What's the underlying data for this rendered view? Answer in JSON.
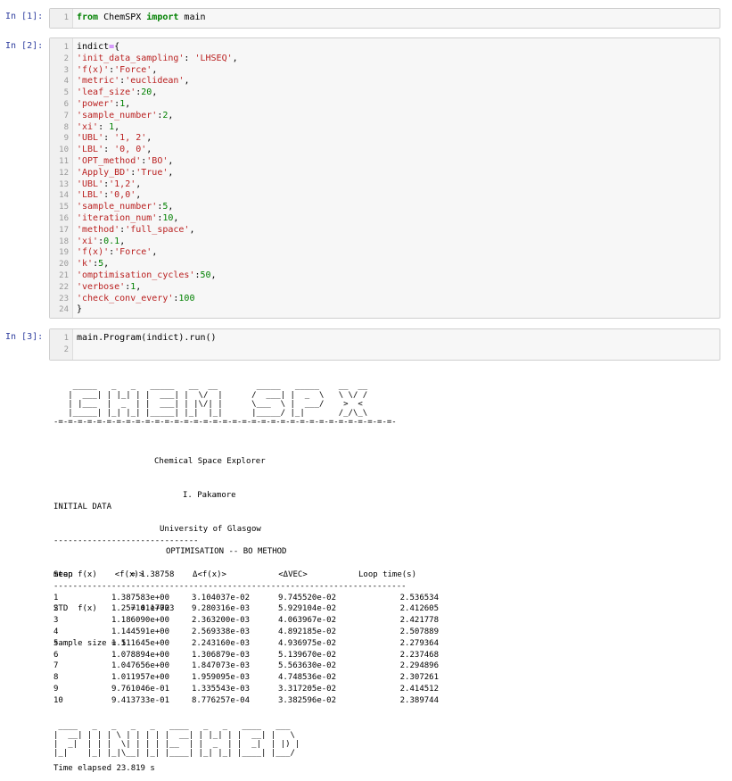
{
  "cells": [
    {
      "prompt": "In [1]:",
      "lines": [
        [
          {
            "t": "from",
            "c": "kw"
          },
          {
            "t": " ChemSPX ",
            "c": ""
          },
          {
            "t": "import",
            "c": "kw"
          },
          {
            "t": " main",
            "c": ""
          }
        ]
      ]
    },
    {
      "prompt": "In [2]:",
      "lines": [
        [
          {
            "t": "indict",
            "c": ""
          },
          {
            "t": "=",
            "c": "op"
          },
          {
            "t": "{",
            "c": ""
          }
        ],
        [
          {
            "t": "'init_data_sampling'",
            "c": "str"
          },
          {
            "t": ": ",
            "c": ""
          },
          {
            "t": "'LHSEQ'",
            "c": "str"
          },
          {
            "t": ",",
            "c": ""
          }
        ],
        [
          {
            "t": "'f(x)'",
            "c": "str"
          },
          {
            "t": ":",
            "c": ""
          },
          {
            "t": "'Force'",
            "c": "str"
          },
          {
            "t": ",",
            "c": ""
          }
        ],
        [
          {
            "t": "'metric'",
            "c": "str"
          },
          {
            "t": ":",
            "c": ""
          },
          {
            "t": "'euclidean'",
            "c": "str"
          },
          {
            "t": ",",
            "c": ""
          }
        ],
        [
          {
            "t": "'leaf_size'",
            "c": "str"
          },
          {
            "t": ":",
            "c": ""
          },
          {
            "t": "20",
            "c": "num"
          },
          {
            "t": ",",
            "c": ""
          }
        ],
        [
          {
            "t": "'power'",
            "c": "str"
          },
          {
            "t": ":",
            "c": ""
          },
          {
            "t": "1",
            "c": "num"
          },
          {
            "t": ",",
            "c": ""
          }
        ],
        [
          {
            "t": "'sample_number'",
            "c": "str"
          },
          {
            "t": ":",
            "c": ""
          },
          {
            "t": "2",
            "c": "num"
          },
          {
            "t": ",",
            "c": ""
          }
        ],
        [
          {
            "t": "'xi'",
            "c": "str"
          },
          {
            "t": ": ",
            "c": ""
          },
          {
            "t": "1",
            "c": "num"
          },
          {
            "t": ",",
            "c": ""
          }
        ],
        [
          {
            "t": "'UBL'",
            "c": "str"
          },
          {
            "t": ": ",
            "c": ""
          },
          {
            "t": "'1, 2'",
            "c": "str"
          },
          {
            "t": ",",
            "c": ""
          }
        ],
        [
          {
            "t": "'LBL'",
            "c": "str"
          },
          {
            "t": ": ",
            "c": ""
          },
          {
            "t": "'0, 0'",
            "c": "str"
          },
          {
            "t": ",",
            "c": ""
          }
        ],
        [
          {
            "t": "'OPT_method'",
            "c": "str"
          },
          {
            "t": ":",
            "c": ""
          },
          {
            "t": "'BO'",
            "c": "str"
          },
          {
            "t": ",",
            "c": ""
          }
        ],
        [
          {
            "t": "'Apply_BD'",
            "c": "str"
          },
          {
            "t": ":",
            "c": ""
          },
          {
            "t": "'True'",
            "c": "str"
          },
          {
            "t": ",",
            "c": ""
          }
        ],
        [
          {
            "t": "'UBL'",
            "c": "str"
          },
          {
            "t": ":",
            "c": ""
          },
          {
            "t": "'1,2'",
            "c": "str"
          },
          {
            "t": ",",
            "c": ""
          }
        ],
        [
          {
            "t": "'LBL'",
            "c": "str"
          },
          {
            "t": ":",
            "c": ""
          },
          {
            "t": "'0,0'",
            "c": "str"
          },
          {
            "t": ",",
            "c": ""
          }
        ],
        [
          {
            "t": "'sample_number'",
            "c": "str"
          },
          {
            "t": ":",
            "c": ""
          },
          {
            "t": "5",
            "c": "num"
          },
          {
            "t": ",",
            "c": ""
          }
        ],
        [
          {
            "t": "'iteration_num'",
            "c": "str"
          },
          {
            "t": ":",
            "c": ""
          },
          {
            "t": "10",
            "c": "num"
          },
          {
            "t": ",",
            "c": ""
          }
        ],
        [
          {
            "t": "'method'",
            "c": "str"
          },
          {
            "t": ":",
            "c": ""
          },
          {
            "t": "'full_space'",
            "c": "str"
          },
          {
            "t": ",",
            "c": ""
          }
        ],
        [
          {
            "t": "'xi'",
            "c": "str"
          },
          {
            "t": ":",
            "c": ""
          },
          {
            "t": "0.1",
            "c": "num"
          },
          {
            "t": ",",
            "c": ""
          }
        ],
        [
          {
            "t": "'f(x)'",
            "c": "str"
          },
          {
            "t": ":",
            "c": ""
          },
          {
            "t": "'Force'",
            "c": "str"
          },
          {
            "t": ",",
            "c": ""
          }
        ],
        [
          {
            "t": "'k'",
            "c": "str"
          },
          {
            "t": ":",
            "c": ""
          },
          {
            "t": "5",
            "c": "num"
          },
          {
            "t": ",",
            "c": ""
          }
        ],
        [
          {
            "t": "'omptimisation_cycles'",
            "c": "str"
          },
          {
            "t": ":",
            "c": ""
          },
          {
            "t": "50",
            "c": "num"
          },
          {
            "t": ",",
            "c": ""
          }
        ],
        [
          {
            "t": "'verbose'",
            "c": "str"
          },
          {
            "t": ":",
            "c": ""
          },
          {
            "t": "1",
            "c": "num"
          },
          {
            "t": ",",
            "c": ""
          }
        ],
        [
          {
            "t": "'check_conv_every'",
            "c": "str"
          },
          {
            "t": ":",
            "c": ""
          },
          {
            "t": "100",
            "c": "num"
          }
        ],
        [
          {
            "t": "}",
            "c": ""
          }
        ]
      ]
    },
    {
      "prompt": "In [3]:",
      "lines": [
        [
          {
            "t": "main.Program(indict).run()",
            "c": ""
          }
        ],
        [
          {
            "t": "",
            "c": ""
          }
        ]
      ]
    }
  ],
  "banner_top": [
    "    _____   _   _   _____   __  __        _____   _____    __  __",
    "   |  ___| | |_| | |  ___| |  \\/  |      /  ___| |  _  \\   \\ \\/ /",
    "   | |___  |  _  | |  ___| | |\\/| |      \\___  \\ |  ___/    >  <",
    "   |_____| |_| |_| |_____| |_|  |_|      |_____/ |_|       /_/\\_\\",
    "-=-=-=-=-=-=-=-=-=-=-=-=-=-=-=-=-=-=-=-=-=-=-=-=-=-=-=-=-=-=-=-=-=-=-=-"
  ],
  "header": {
    "title": "Chemical Space Explorer",
    "author": "I. Pakamore",
    "affiliation": "University of Glasgow"
  },
  "initial": {
    "heading": "INITIAL DATA",
    "rule": "------------------------------",
    "mean": "mean f(x)       = 1.38758",
    "std": "STD  f(x)       = 0.17723",
    "size": "sample size = 5"
  },
  "opt_heading": "OPTIMISATION -- BO METHOD",
  "table": {
    "headers": [
      "Step",
      "<f(x)>",
      "Δ<f(x)>",
      "<ΔVEC>",
      "Loop time(s)"
    ],
    "rule": "-------------------------------------------------------------------------",
    "rows": [
      [
        "1",
        "1.387583e+00",
        "3.104037e-02",
        "9.745520e-02",
        "2.536534"
      ],
      [
        "2",
        "1.257141e+00",
        "9.280316e-03",
        "5.929104e-02",
        "2.412605"
      ],
      [
        "3",
        "1.186090e+00",
        "2.363200e-03",
        "4.063967e-02",
        "2.421778"
      ],
      [
        "4",
        "1.144591e+00",
        "2.569338e-03",
        "4.892185e-02",
        "2.507889"
      ],
      [
        "5",
        "1.111645e+00",
        "2.243160e-03",
        "4.936975e-02",
        "2.279364"
      ],
      [
        "6",
        "1.078894e+00",
        "1.306879e-03",
        "5.139670e-02",
        "2.237468"
      ],
      [
        "7",
        "1.047656e+00",
        "1.847073e-03",
        "5.563630e-02",
        "2.294896"
      ],
      [
        "8",
        "1.011957e+00",
        "1.959095e-03",
        "4.748536e-02",
        "2.307261"
      ],
      [
        "9",
        "9.761046e-01",
        "1.335543e-03",
        "3.317205e-02",
        "2.414512"
      ],
      [
        "10",
        "9.413733e-01",
        "8.776257e-04",
        "3.382596e-02",
        "2.389744"
      ]
    ]
  },
  "banner_bottom": [
    " ____   _   _   _   _   ____   _   _   ____   ___",
    "|  __| | | | \\ | | | | |  __| | |_| | |  __| |   \\",
    "|  _|  | | |  \\| | | | |__  | |  _  | |  _|  | |) |",
    "|_|    |_| |_|\\__| |_| |____| |_| |_| |____| |___/"
  ],
  "elapsed": "Time elapsed 23.819 s"
}
